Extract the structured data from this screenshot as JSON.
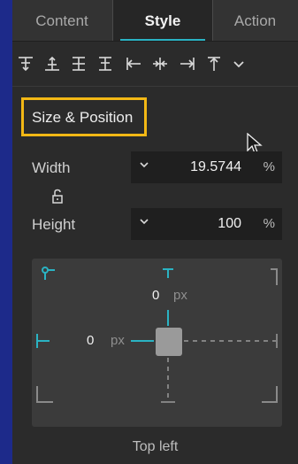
{
  "tabs": [
    {
      "label": "Content",
      "active": false
    },
    {
      "label": "Style",
      "active": true
    },
    {
      "label": "Action",
      "active": false
    }
  ],
  "toolbar": {
    "icons": [
      "align-top-icon",
      "align-vertical-center-icon",
      "align-bottom-icon",
      "distribute-vertical-icon",
      "align-left-icon",
      "align-horizontal-center-icon",
      "align-right-icon",
      "align-top-edge-icon",
      "chevron-down-icon"
    ]
  },
  "section": {
    "title": "Size & Position"
  },
  "size": {
    "width": {
      "label": "Width",
      "value": "19.5744",
      "unit": "%"
    },
    "height": {
      "label": "Height",
      "value": "100",
      "unit": "%"
    }
  },
  "position": {
    "top_value": "0",
    "top_unit": "px",
    "left_value": "0",
    "left_unit": "px",
    "anchor": "Top left"
  },
  "colors": {
    "accent": "#2ab3c3",
    "highlight": "#f3b815",
    "background": "#2b2b2b"
  }
}
